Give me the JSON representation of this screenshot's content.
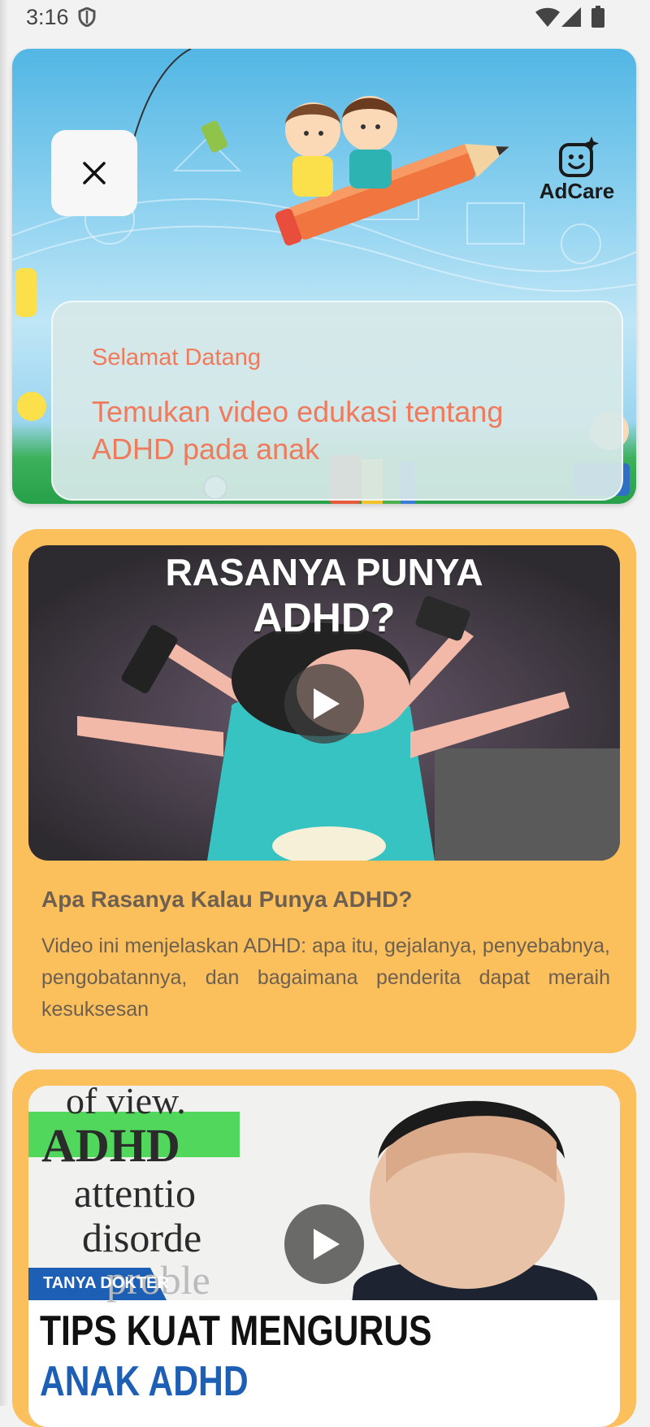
{
  "status_bar": {
    "time": "3:16"
  },
  "hero": {
    "brand_name": "AdCare",
    "greeting": "Selamat Datang",
    "headline": "Temukan video edukasi tentang ADHD pada anak"
  },
  "videos": [
    {
      "thumbnail_text": [
        "RASANYA PUNYA",
        "ADHD?"
      ],
      "title": "Apa Rasanya Kalau Punya ADHD?",
      "description": "Video ini menjelaskan ADHD: apa itu, gejalanya, penyebabnya, pengobatannya, dan bagaimana penderita dapat meraih kesuksesan"
    },
    {
      "thumbnail_badge": "TANYA DOKTER",
      "thumbnail_text": [
        "TIPS KUAT MENGURUS",
        "ANAK ADHD"
      ],
      "thumbnail_dictionary": [
        "of view.",
        "ADHD",
        "attentio",
        "disorde",
        "proble"
      ]
    }
  ],
  "colors": {
    "accent": "#f07a5c",
    "card_background": "#fbbf5c",
    "card_text": "#6e6051"
  }
}
